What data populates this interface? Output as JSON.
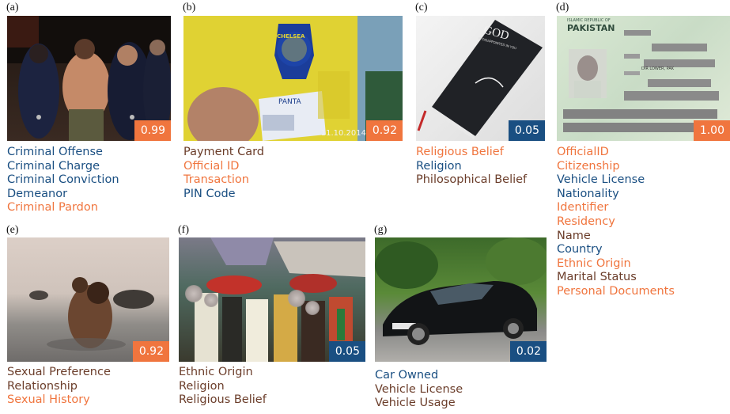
{
  "colors": {
    "orange": "#f0753e",
    "blue": "#1a4f82",
    "brown": "#6b3d2a"
  },
  "panels": [
    {
      "tag": "(a)",
      "score": "0.99",
      "score_color": "orange",
      "labels": [
        {
          "text": "Criminal Offense",
          "color": "blue"
        },
        {
          "text": "Criminal Charge",
          "color": "blue"
        },
        {
          "text": "Criminal Conviction",
          "color": "blue"
        },
        {
          "text": "Demeanor",
          "color": "blue"
        },
        {
          "text": "Criminal Pardon",
          "color": "orange"
        }
      ]
    },
    {
      "tag": "(b)",
      "score": "0.92",
      "score_color": "orange",
      "watermark": "11.10.2014",
      "card_text": "PANTA",
      "logo_text": "CHELSEA",
      "labels": [
        {
          "text": "Payment Card",
          "color": "brown"
        },
        {
          "text": "Official ID",
          "color": "orange"
        },
        {
          "text": "Transaction",
          "color": "orange"
        },
        {
          "text": "PIN Code",
          "color": "blue"
        }
      ]
    },
    {
      "tag": "(c)",
      "score": "0.05",
      "score_color": "blue",
      "book_title": "GOD",
      "book_subtitle": "IS DISAPPOINTED IN YOU",
      "labels": [
        {
          "text": "Religious Belief",
          "color": "orange"
        },
        {
          "text": "Religion",
          "color": "blue"
        },
        {
          "text": "Philosophical Belief",
          "color": "brown"
        }
      ]
    },
    {
      "tag": "(d)",
      "score": "1.00",
      "score_color": "orange",
      "doc_header": "PAKISTAN",
      "doc_sub": "ISLAMIC REPUBLIC OF",
      "doc_field": "DIR LOWER, PAK",
      "labels": [
        {
          "text": "OfficialID",
          "color": "orange"
        },
        {
          "text": "Citizenship",
          "color": "orange"
        },
        {
          "text": "Vehicle License",
          "color": "blue"
        },
        {
          "text": "Nationality",
          "color": "blue"
        },
        {
          "text": "Identifier",
          "color": "orange"
        },
        {
          "text": "Residency",
          "color": "orange"
        },
        {
          "text": "Name",
          "color": "brown"
        },
        {
          "text": "Country",
          "color": "blue"
        },
        {
          "text": "Ethnic Origin",
          "color": "orange"
        },
        {
          "text": "Marital Status",
          "color": "brown"
        },
        {
          "text": "Personal Documents",
          "color": "orange"
        }
      ]
    },
    {
      "tag": "(e)",
      "score": "0.92",
      "score_color": "orange",
      "labels": [
        {
          "text": "Sexual Preference",
          "color": "brown"
        },
        {
          "text": "Relationship",
          "color": "brown"
        },
        {
          "text": "Sexual History",
          "color": "orange"
        }
      ]
    },
    {
      "tag": "(f)",
      "score": "0.05",
      "score_color": "blue",
      "labels": [
        {
          "text": "Ethnic Origin",
          "color": "brown"
        },
        {
          "text": "Religion",
          "color": "brown"
        },
        {
          "text": "Religious Belief",
          "color": "brown"
        }
      ]
    },
    {
      "tag": "(g)",
      "score": "0.02",
      "score_color": "blue",
      "labels": [
        {
          "text": "Car Owned",
          "color": "blue"
        },
        {
          "text": "Vehicle License",
          "color": "brown"
        },
        {
          "text": "Vehicle Usage",
          "color": "brown"
        }
      ]
    }
  ]
}
